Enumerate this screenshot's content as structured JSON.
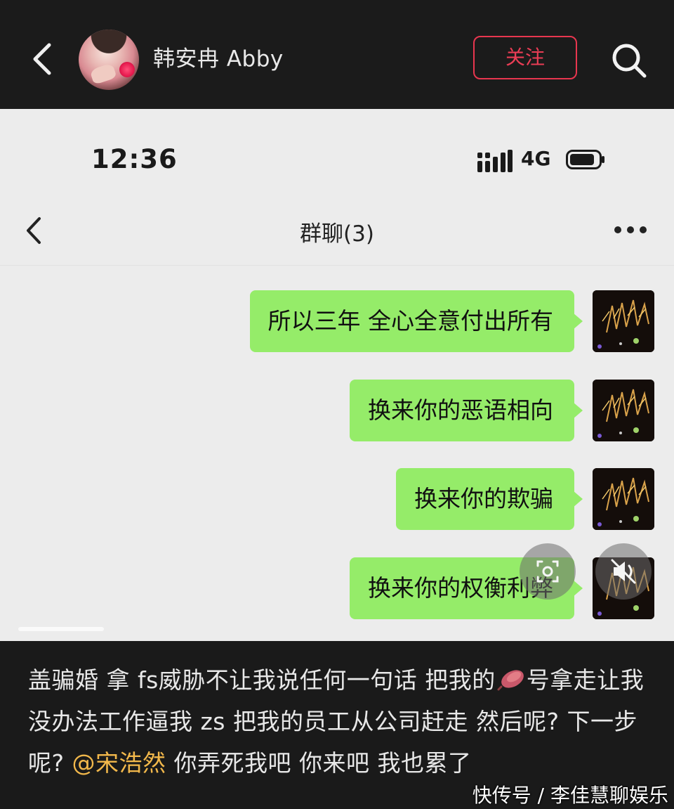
{
  "topbar": {
    "account_name": "韩安冉 Abby",
    "follow_label": "关注"
  },
  "screenshot": {
    "status": {
      "time": "12:36",
      "network": "4G"
    },
    "chat": {
      "title": "群聊(3)",
      "messages": [
        {
          "text": "所以三年 全心全意付出所有"
        },
        {
          "text": "换来你的恶语相向"
        },
        {
          "text": "换来你的欺骗"
        },
        {
          "text": "换来你的权衡利弊"
        }
      ]
    }
  },
  "caption": {
    "part1": "盖骗婚 拿 fs威胁不让我说任何一句话 把我的",
    "part2": "号拿走让我没办法工作逼我 zs 把我的员工从公司赶走 然后呢? 下一步呢? ",
    "mention": "@宋浩然",
    "part3": " 你弄死我吧 你来吧 我也累了"
  },
  "watermark": "快传号 / 李佳慧聊娱乐",
  "colors": {
    "follow_accent": "#e8364f",
    "bubble_green": "#95ec69",
    "mention_gold": "#f2b84b"
  },
  "icons": [
    "back-arrow-icon",
    "search-icon",
    "signal-icon",
    "battery-icon",
    "more-icon",
    "scan-icon",
    "mute-icon",
    "sweet-potato-icon"
  ]
}
